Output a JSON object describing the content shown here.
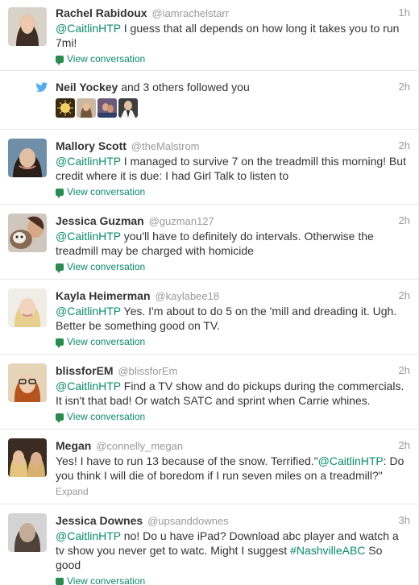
{
  "feed": {
    "items": [
      {
        "fullname": "Rachel Rabidoux",
        "username": "@iamrachelstarr",
        "time": "1h",
        "text_parts": [
          {
            "t": "@CaitlinHTP",
            "c": "mention"
          },
          {
            "t": " I guess that all depends on how long it takes you to run 7mi!",
            "c": ""
          }
        ],
        "action": "View conversation"
      },
      {
        "fullname": "Mallory Scott",
        "username": "@theMalstrom",
        "time": "2h",
        "text_parts": [
          {
            "t": "@CaitlinHTP",
            "c": "mention"
          },
          {
            "t": " I managed to survive 7 on the treadmill this morning! But credit where it is due: I had Girl Talk to listen to",
            "c": ""
          }
        ],
        "action": "View conversation"
      },
      {
        "fullname": "Jessica Guzman",
        "username": "@guzman127",
        "time": "2h",
        "text_parts": [
          {
            "t": "@CaitlinHTP",
            "c": "mention"
          },
          {
            "t": " you'll have to definitely do intervals. Otherwise the treadmill may be charged with homicide",
            "c": ""
          }
        ],
        "action": "View conversation"
      },
      {
        "fullname": "Kayla Heimerman",
        "username": "@kaylabee18",
        "time": "2h",
        "text_parts": [
          {
            "t": "@CaitlinHTP",
            "c": "mention"
          },
          {
            "t": " Yes. I'm about to do 5 on the 'mill and dreading it. Ugh. Better be something good on TV.",
            "c": ""
          }
        ],
        "action": "View conversation"
      },
      {
        "fullname": "blissforEM",
        "username": "@blissforEm",
        "time": "2h",
        "text_parts": [
          {
            "t": "@CaitlinHTP",
            "c": "mention"
          },
          {
            "t": " Find a TV show and do pickups during the commercials. It isn't that bad! Or watch SATC and sprint when Carrie whines.",
            "c": ""
          }
        ],
        "action": "View conversation"
      },
      {
        "fullname": "Megan",
        "username": "@connelly_megan",
        "time": "2h",
        "text_parts": [
          {
            "t": "Yes! I have to run 13 because of the snow. Terrified.\"",
            "c": ""
          },
          {
            "t": "@CaitlinHTP",
            "c": "mention"
          },
          {
            "t": ": Do you think I will die of boredom if I run seven miles on a treadmill?\"",
            "c": ""
          }
        ],
        "action": "Expand"
      },
      {
        "fullname": "Jessica Downes",
        "username": "@upsanddownes",
        "time": "3h",
        "text_parts": [
          {
            "t": "@CaitlinHTP",
            "c": "mention"
          },
          {
            "t": " no! Do u have iPad? Download abc player and watch a tv show you never get to watc. Might I suggest ",
            "c": ""
          },
          {
            "t": "#NashvilleABC",
            "c": "hashtag"
          },
          {
            "t": " So good",
            "c": ""
          }
        ],
        "action": "View conversation"
      }
    ],
    "follow_notice": {
      "name": "Neil Yockey",
      "rest": " and 3 others followed you",
      "time": "2h",
      "icon": "twitter-bird-icon"
    }
  },
  "colors": {
    "link": "#0a8b69",
    "muted": "#999999",
    "bird": "#55acee"
  }
}
